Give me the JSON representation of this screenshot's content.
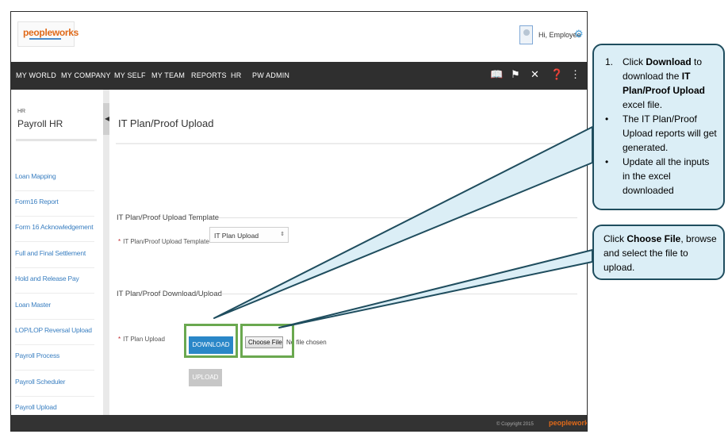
{
  "header": {
    "logo_text": "peopleworks",
    "greeting": "Hi, Employee",
    "icons": [
      "avatar",
      "gear-icon"
    ]
  },
  "nav": {
    "items": [
      "MY WORLD",
      "MY COMPANY",
      "MY SELF",
      "MY TEAM",
      "REPORTS",
      "HR",
      "PW ADMIN"
    ],
    "icons": [
      "book-icon",
      "flag-icon",
      "tools-icon",
      "help-icon",
      "share-icon"
    ]
  },
  "sidebar": {
    "module": "HR",
    "title": "Payroll HR",
    "items": [
      "Loan Mapping",
      "Form16 Report",
      "Form 16 Acknowledgement",
      "Full and Final Settlement",
      "Hold and Release Pay",
      "Loan Master",
      "LOP/LOP Reversal Upload",
      "Payroll Process",
      "Payroll Scheduler",
      "Payroll Upload"
    ]
  },
  "main": {
    "title": "IT Plan/Proof Upload",
    "required_note": "Req",
    "template_section": "IT Plan/Proof Upload Template",
    "template_label": "IT Plan/Proof Upload Template",
    "template_selected": "IT Plan Upload",
    "download_section": "IT Plan/Proof Download/Upload",
    "plan_label": "IT Plan Upload",
    "download_label": "DOWNLOAD",
    "choose_label": "Choose File",
    "file_status": "No file chosen",
    "upload_label": "UPLOAD"
  },
  "footer": {
    "copyright": "© Copyright 2015",
    "logo": "peopleworks"
  },
  "callouts": {
    "download": {
      "step_number": "1.",
      "step_prefix": "Click ",
      "step_bold1": "Download",
      "step_mid": " to download the ",
      "step_bold2": "IT Plan/Proof Upload",
      "step_suffix": " excel file.",
      "bullet1": "The IT Plan/Proof Upload reports will get generated.",
      "bullet2": "Update all the inputs in the excel downloaded",
      "bullet_mark": "•"
    },
    "choose": {
      "prefix": "Click ",
      "bold": "Choose File",
      "suffix": ", browse and select the file to upload."
    }
  },
  "colors": {
    "navbar": "#2f2f2f",
    "link": "#3a7fc1",
    "primary_button": "#2a87c8",
    "highlight": "#6aa84f",
    "callout_fill": "#dbeef6",
    "callout_border": "#1f4d5e",
    "required_star": "#c0282d"
  }
}
